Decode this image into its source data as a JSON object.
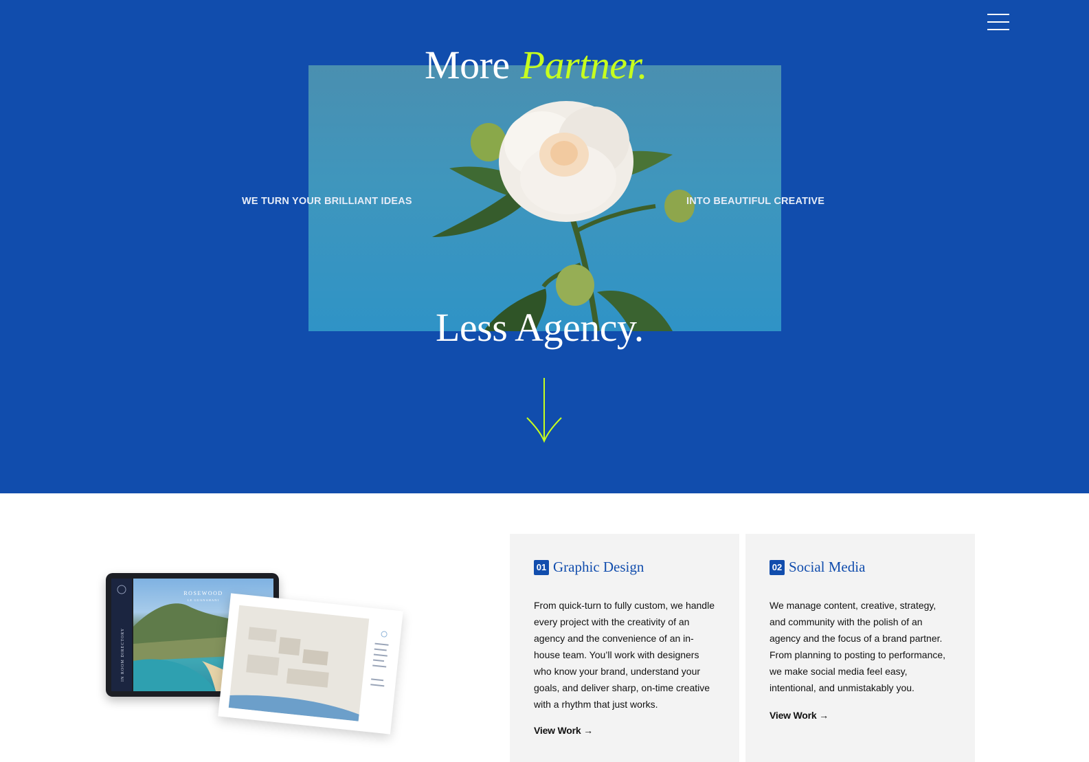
{
  "header": {
    "menu_icon": "hamburger-menu-icon"
  },
  "hero": {
    "headline_top_plain": "More",
    "headline_top_accent": "Partner.",
    "headline_bottom": "Less Agency.",
    "tagline_left": "WE TURN YOUR BRILLIANT IDEAS",
    "tagline_right": "INTO BEAUTIFUL CREATIVE",
    "scroll_icon": "arrow-down-icon",
    "colors": {
      "background": "#114dad",
      "accent": "#c7ff1e",
      "photo_sky": "#3f96bd"
    }
  },
  "services": {
    "illustration": {
      "tablet_brand": "ROSEWOOD",
      "tablet_sub": "LE GUANAHANI",
      "tablet_rail": "IN ROOM DIRECTORY"
    },
    "items": [
      {
        "number": "01",
        "title": "Graphic Design",
        "description": "From quick-turn to fully custom, we handle every project with the creativity of an agency and the convenience of an in-house team. You’ll work with designers who know your brand, understand your goals, and deliver sharp, on-time creative with a rhythm that just works.",
        "link": "View Work →"
      },
      {
        "number": "02",
        "title": "Social Media",
        "description": "We manage content, creative, strategy, and community with the polish of an agency and the focus of a brand partner. From planning to posting to performance, we make social media feel easy, intentional, and unmistakably you.",
        "link": "View Work →"
      }
    ]
  }
}
